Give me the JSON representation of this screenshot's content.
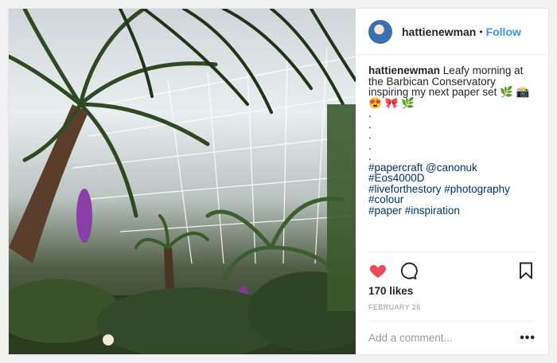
{
  "post": {
    "username": "hattienewman",
    "separator": "•",
    "follow_label": "Follow",
    "caption": {
      "username": "hattienewman",
      "text": "Leafy morning at the Barbican Conservatory inspiring my next paper set 🌿 📸 😍 🎀 🌿",
      "dots": [
        ".",
        ".",
        ".",
        ".",
        "."
      ],
      "hashtags": [
        "#papercraft @canonuk #Eos4000D",
        "#liveforthestory #photography #colour",
        "#paper #inspiration"
      ]
    },
    "likes_text": "170 likes",
    "date_text": "FEBRUARY 26",
    "comment_placeholder": "Add a comment...",
    "more_label": "•••"
  },
  "icons": {
    "like": "heart-icon",
    "comment": "comment-icon",
    "save": "bookmark-icon",
    "accent_like": "#ed4956"
  }
}
